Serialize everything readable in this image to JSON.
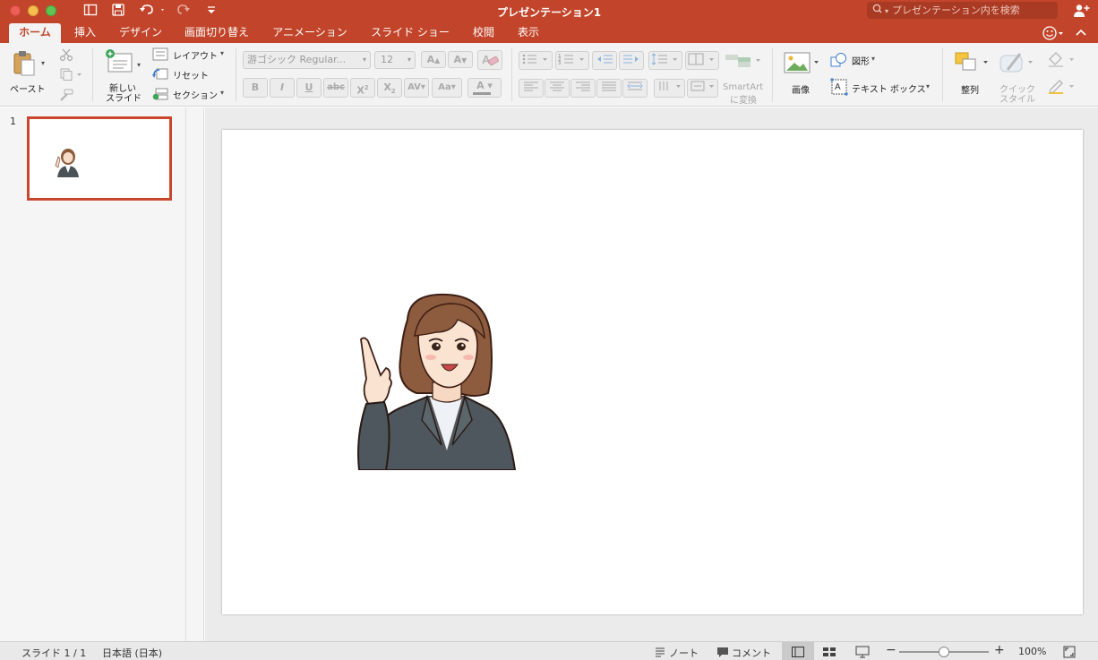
{
  "window": {
    "title": "プレゼンテーション1",
    "search_placeholder": "プレゼンテーション内を検索"
  },
  "tabs": [
    {
      "label": "ホーム"
    },
    {
      "label": "挿入"
    },
    {
      "label": "デザイン"
    },
    {
      "label": "画面切り替え"
    },
    {
      "label": "アニメーション"
    },
    {
      "label": "スライド ショー"
    },
    {
      "label": "校閲"
    },
    {
      "label": "表示"
    }
  ],
  "ribbon": {
    "paste": "ペースト",
    "new_slide_1": "新しい",
    "new_slide_2": "スライド",
    "layout": "レイアウト",
    "reset": "リセット",
    "section": "セクション",
    "font_name": "游ゴシック Regular...",
    "font_size": "12",
    "smartart_1": "SmartArt",
    "smartart_2": "に変換",
    "picture": "画像",
    "shapes": "図形",
    "text_box": "テキスト ボックス",
    "arrange": "整列",
    "quick_styles_1": "クイック",
    "quick_styles_2": "スタイル"
  },
  "thumbnail": {
    "number": "1"
  },
  "status": {
    "slide_count": "スライド 1 / 1",
    "language": "日本語 (日本)",
    "notes": "ノート",
    "comments": "コメント",
    "zoom": "100%",
    "zoom_level": 0.5
  },
  "colors": {
    "accent": "#c2452b",
    "selection": "#c9472f"
  }
}
